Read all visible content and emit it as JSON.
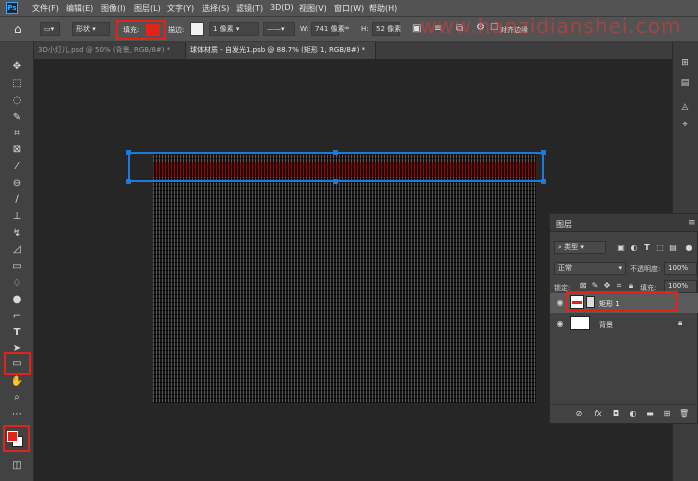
{
  "menu": [
    "文件(F)",
    "编辑(E)",
    "图像(I)",
    "图层(L)",
    "文字(Y)",
    "选择(S)",
    "滤镜(T)",
    "3D(D)",
    "视图(V)",
    "窗口(W)",
    "帮助(H)"
  ],
  "watermark": "www.hanzidianshei.com",
  "options": {
    "shape_mode": "形状",
    "fill_label": "填充:",
    "fill_color": "#e2231a",
    "stroke_label": "描边:",
    "stroke_width": "1 像素",
    "w_label": "W:",
    "w_value": "741 像素",
    "h_label": "H:",
    "h_value": "52 像素",
    "align_edges": "对齐边缘"
  },
  "tabs": [
    {
      "label": "3D小灯儿.psd @ 50% (背景, RGB/8#) *",
      "active": false
    },
    {
      "label": "球体材质 - 自发光1.psb @ 88.7% (矩形 1, RGB/8#) *",
      "active": true
    }
  ],
  "tools": [
    "move-tool",
    "marquee-tool",
    "lasso-tool",
    "quick-select-tool",
    "crop-tool",
    "frame-tool",
    "eyedropper-tool",
    "healing-tool",
    "brush-tool",
    "stamp-tool",
    "history-brush-tool",
    "eraser-tool",
    "gradient-tool",
    "blur-tool",
    "dodge-tool",
    "pen-tool",
    "type-tool",
    "path-select-tool",
    "rectangle-tool",
    "hand-tool",
    "zoom-tool",
    "more-tools"
  ],
  "colors": {
    "foreground": "#e2231a",
    "background": "#ffffff",
    "highlight": "#e2231a",
    "selection": "#1d7ad8"
  },
  "layers_panel": {
    "title": "图层",
    "filter_kind": "类型",
    "blend_mode": "正常",
    "opacity_label": "不透明度:",
    "opacity_value": "100%",
    "lock_label": "锁定:",
    "fill_label": "填充:",
    "fill_value": "100%",
    "layers": [
      {
        "name": "矩形 1",
        "selected": true
      },
      {
        "name": "背景",
        "selected": false
      }
    ],
    "footer_icons": [
      "link-icon",
      "fx-icon",
      "mask-icon",
      "adjustment-icon",
      "group-icon",
      "new-layer-icon",
      "trash-icon"
    ]
  }
}
